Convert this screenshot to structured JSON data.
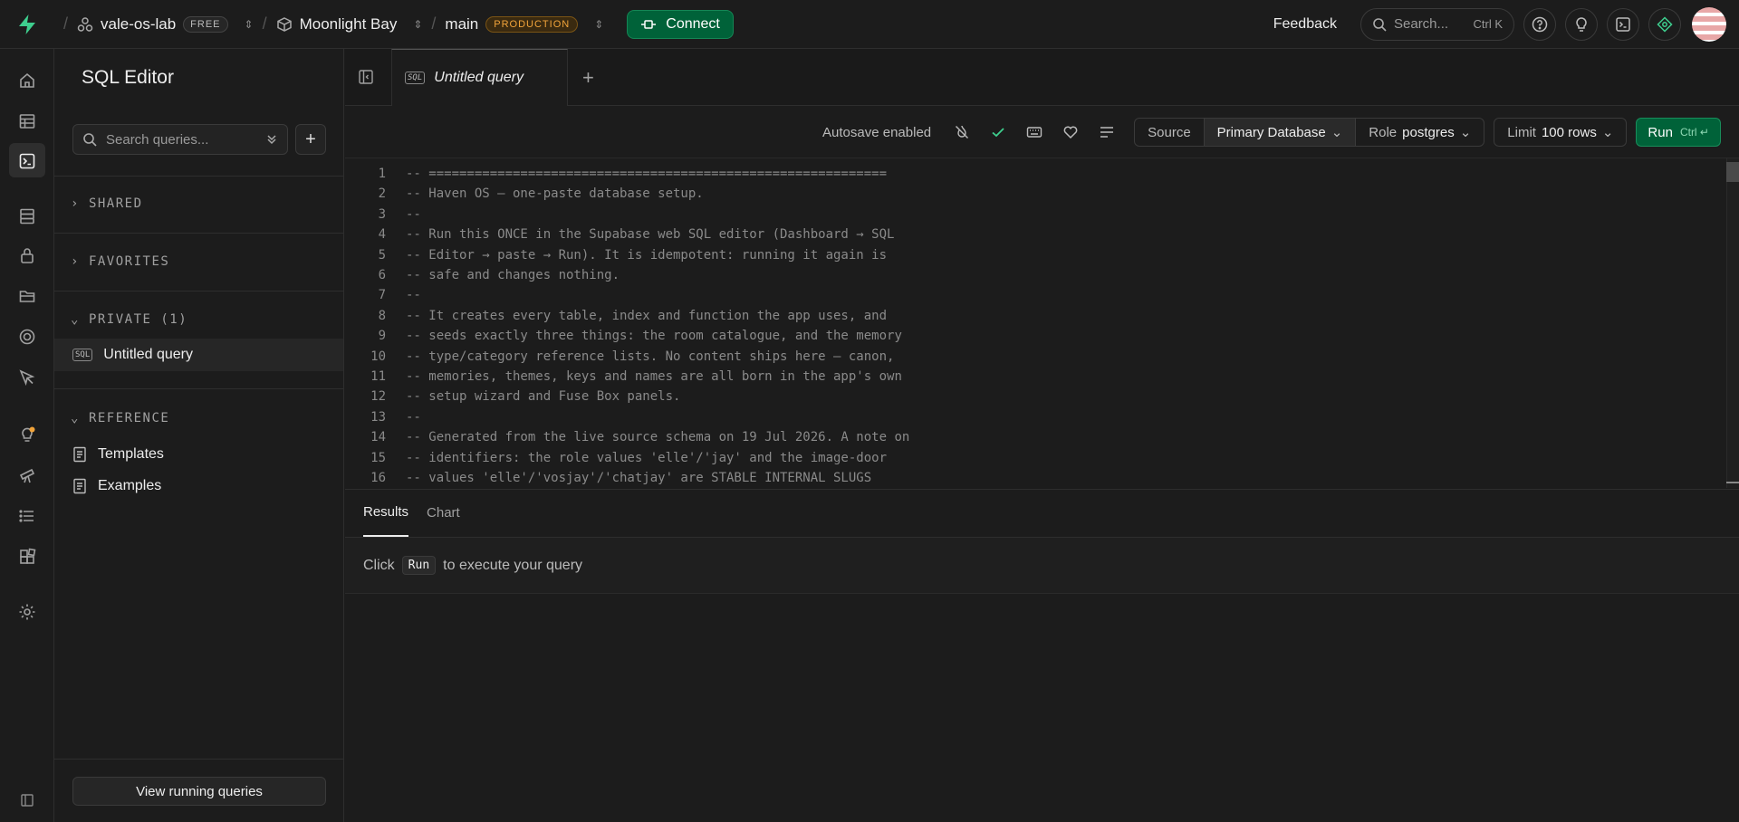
{
  "topbar": {
    "org": "vale-os-lab",
    "org_plan": "FREE",
    "project": "Moonlight Bay",
    "branch": "main",
    "branch_env": "PRODUCTION",
    "connect_label": "Connect",
    "feedback_label": "Feedback",
    "search_placeholder": "Search...",
    "search_shortcut": "Ctrl K"
  },
  "sidebar": {
    "title": "SQL Editor",
    "search_placeholder": "Search queries...",
    "sections": {
      "shared": "SHARED",
      "favorites": "FAVORITES",
      "private": "PRIVATE (1)",
      "reference": "REFERENCE"
    },
    "private_items": [
      {
        "tag": "SQL",
        "label": "Untitled query"
      }
    ],
    "reference_items": [
      {
        "label": "Templates"
      },
      {
        "label": "Examples"
      }
    ],
    "running_button": "View running queries"
  },
  "tabs": [
    {
      "tag": "SQL",
      "label": "Untitled query"
    }
  ],
  "toolbar": {
    "autosave": "Autosave enabled",
    "source_label": "Source",
    "source_value": "Primary Database",
    "role_label": "Role",
    "role_value": "postgres",
    "limit_label": "Limit",
    "limit_value": "100 rows",
    "run_label": "Run",
    "run_shortcut": "Ctrl ↵"
  },
  "editor": {
    "lines": [
      {
        "n": "1",
        "text": "-- ============================================================"
      },
      {
        "n": "2",
        "text": "-- Haven OS — one-paste database setup."
      },
      {
        "n": "3",
        "text": "--"
      },
      {
        "n": "4",
        "text": "-- Run this ONCE in the Supabase web SQL editor (Dashboard → SQL"
      },
      {
        "n": "5",
        "text": "-- Editor → paste → Run). It is idempotent: running it again is"
      },
      {
        "n": "6",
        "text": "-- safe and changes nothing."
      },
      {
        "n": "7",
        "text": "--"
      },
      {
        "n": "8",
        "text": "-- It creates every table, index and function the app uses, and"
      },
      {
        "n": "9",
        "text": "-- seeds exactly three things: the room catalogue, and the memory"
      },
      {
        "n": "10",
        "text": "-- type/category reference lists. No content ships here — canon,"
      },
      {
        "n": "11",
        "text": "-- memories, themes, keys and names are all born in the app's own"
      },
      {
        "n": "12",
        "text": "-- setup wizard and Fuse Box panels."
      },
      {
        "n": "13",
        "text": "--"
      },
      {
        "n": "14",
        "text": "-- Generated from the live source schema on 19 Jul 2026. A note on"
      },
      {
        "n": "15",
        "text": "-- identifiers: the role values 'elle'/'jay' and the image-door"
      },
      {
        "n": "16",
        "text": "-- values 'elle'/'vosjay'/'chatjay' are STABLE INTERNAL SLUGS"
      }
    ]
  },
  "results": {
    "tabs": [
      "Results",
      "Chart"
    ],
    "msg_before": "Click",
    "msg_key": "Run",
    "msg_after": "to execute your query"
  },
  "colors": {
    "accent": "#3ecf8e",
    "run_bg": "#006239",
    "production": "#f0a33a"
  }
}
